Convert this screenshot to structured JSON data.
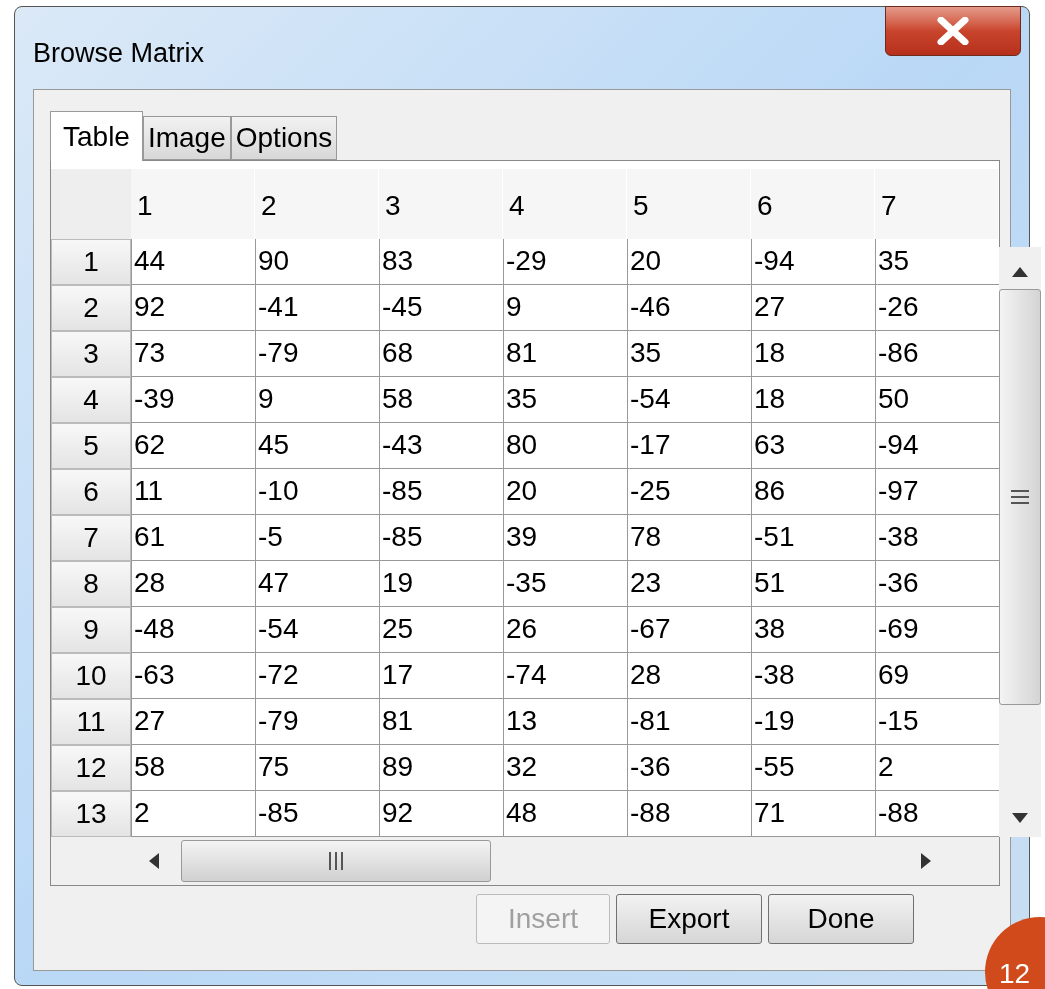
{
  "window": {
    "title": "Browse Matrix"
  },
  "tabs": [
    {
      "label": "Table",
      "selected": true
    },
    {
      "label": "Image",
      "selected": false
    },
    {
      "label": "Options",
      "selected": false
    }
  ],
  "table": {
    "columns": [
      "1",
      "2",
      "3",
      "4",
      "5",
      "6",
      "7"
    ],
    "rows": [
      {
        "header": "1",
        "cells": [
          "44",
          "90",
          "83",
          "-29",
          "20",
          "-94",
          "35"
        ]
      },
      {
        "header": "2",
        "cells": [
          "92",
          "-41",
          "-45",
          "9",
          "-46",
          "27",
          "-26"
        ]
      },
      {
        "header": "3",
        "cells": [
          "73",
          "-79",
          "68",
          "81",
          "35",
          "18",
          "-86"
        ]
      },
      {
        "header": "4",
        "cells": [
          "-39",
          "9",
          "58",
          "35",
          "-54",
          "18",
          "50"
        ]
      },
      {
        "header": "5",
        "cells": [
          "62",
          "45",
          "-43",
          "80",
          "-17",
          "63",
          "-94"
        ]
      },
      {
        "header": "6",
        "cells": [
          "11",
          "-10",
          "-85",
          "20",
          "-25",
          "86",
          "-97"
        ]
      },
      {
        "header": "7",
        "cells": [
          "61",
          "-5",
          "-85",
          "39",
          "78",
          "-51",
          "-38"
        ]
      },
      {
        "header": "8",
        "cells": [
          "28",
          "47",
          "19",
          "-35",
          "23",
          "51",
          "-36"
        ]
      },
      {
        "header": "9",
        "cells": [
          "-48",
          "-54",
          "25",
          "26",
          "-67",
          "38",
          "-69"
        ]
      },
      {
        "header": "10",
        "cells": [
          "-63",
          "-72",
          "17",
          "-74",
          "28",
          "-38",
          "69"
        ]
      },
      {
        "header": "11",
        "cells": [
          "27",
          "-79",
          "81",
          "13",
          "-81",
          "-19",
          "-15"
        ]
      },
      {
        "header": "12",
        "cells": [
          "58",
          "75",
          "89",
          "32",
          "-36",
          "-55",
          "2"
        ]
      },
      {
        "header": "13",
        "cells": [
          "2",
          "-85",
          "92",
          "48",
          "-88",
          "71",
          "-88"
        ]
      }
    ]
  },
  "buttons": [
    {
      "label": "Insert",
      "disabled": true
    },
    {
      "label": "Export",
      "disabled": false
    },
    {
      "label": "Done",
      "disabled": false
    }
  ],
  "page_badge": "12"
}
